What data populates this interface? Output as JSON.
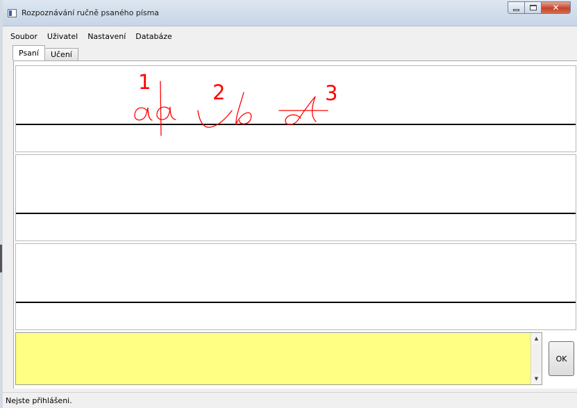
{
  "window": {
    "title": "Rozpoznávání ručně psaného písma"
  },
  "menu": {
    "items": [
      "Soubor",
      "Uživatel",
      "Nastavení",
      "Databáze"
    ]
  },
  "tabs": [
    {
      "label": "Psaní",
      "active": true
    },
    {
      "label": "Učení",
      "active": false
    }
  ],
  "canvas": {
    "annotations": [
      "1",
      "2",
      "3"
    ],
    "ink_color": "#ff0000"
  },
  "input": {
    "value": "",
    "background": "#ffff84"
  },
  "buttons": {
    "ok_label": "OK"
  },
  "status": {
    "text": "Nejste přihlášeni."
  },
  "icons": {
    "minimize": "minimize-icon",
    "maximize": "maximize-icon",
    "close": "close-icon",
    "scroll_up": "scroll-up-arrow-icon",
    "scroll_down": "scroll-down-arrow-icon"
  }
}
